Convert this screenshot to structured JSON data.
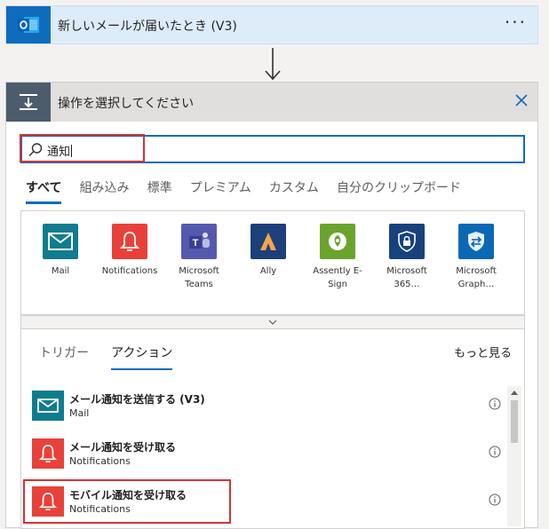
{
  "trigger": {
    "title": "新しいメールが届いたとき (V3)",
    "more": "···",
    "icon": "outlook-icon"
  },
  "panel": {
    "title": "操作を選択してください",
    "icon": "operation-icon",
    "close_icon": "close-icon"
  },
  "search": {
    "value": "通知",
    "icon": "search-icon"
  },
  "filters": [
    {
      "label": "すべて",
      "active": true
    },
    {
      "label": "組み込み",
      "active": false
    },
    {
      "label": "標準",
      "active": false
    },
    {
      "label": "プレミアム",
      "active": false
    },
    {
      "label": "カスタム",
      "active": false
    },
    {
      "label": "自分のクリップボード",
      "active": false
    }
  ],
  "connectors": [
    {
      "label": "Mail",
      "icon": "mail-icon",
      "color": "#0f7c8f"
    },
    {
      "label": "Notifications",
      "icon": "bell-icon",
      "color": "#e8413a"
    },
    {
      "label": "Microsoft Teams",
      "icon": "teams-icon",
      "color": "#5558af"
    },
    {
      "label": "Ally",
      "icon": "ally-icon",
      "color": "#1d3f7a"
    },
    {
      "label": "Assently E-Sign",
      "icon": "assently-icon",
      "color": "#6aa42d"
    },
    {
      "label": "Microsoft 365…",
      "icon": "shield-lock-icon",
      "color": "#18427e"
    },
    {
      "label": "Microsoft Graph…",
      "icon": "graph-icon",
      "color": "#0a68b6"
    }
  ],
  "expand_icon": "chevron-down-icon",
  "result_tabs": [
    {
      "label": "トリガー",
      "active": false
    },
    {
      "label": "アクション",
      "active": true
    }
  ],
  "see_more": "もっと見る",
  "results": [
    {
      "title": "メール通知を送信する (V3)",
      "subtitle": "Mail",
      "icon": "mail-icon",
      "color": "#0f7c8f"
    },
    {
      "title": "メール通知を受け取る",
      "subtitle": "Notifications",
      "icon": "bell-icon",
      "color": "#e8413a"
    },
    {
      "title": "モバイル通知を受け取る",
      "subtitle": "Notifications",
      "icon": "bell-icon",
      "color": "#e8413a"
    }
  ],
  "accent": "#0f6cbd",
  "highlight": "#d13438"
}
